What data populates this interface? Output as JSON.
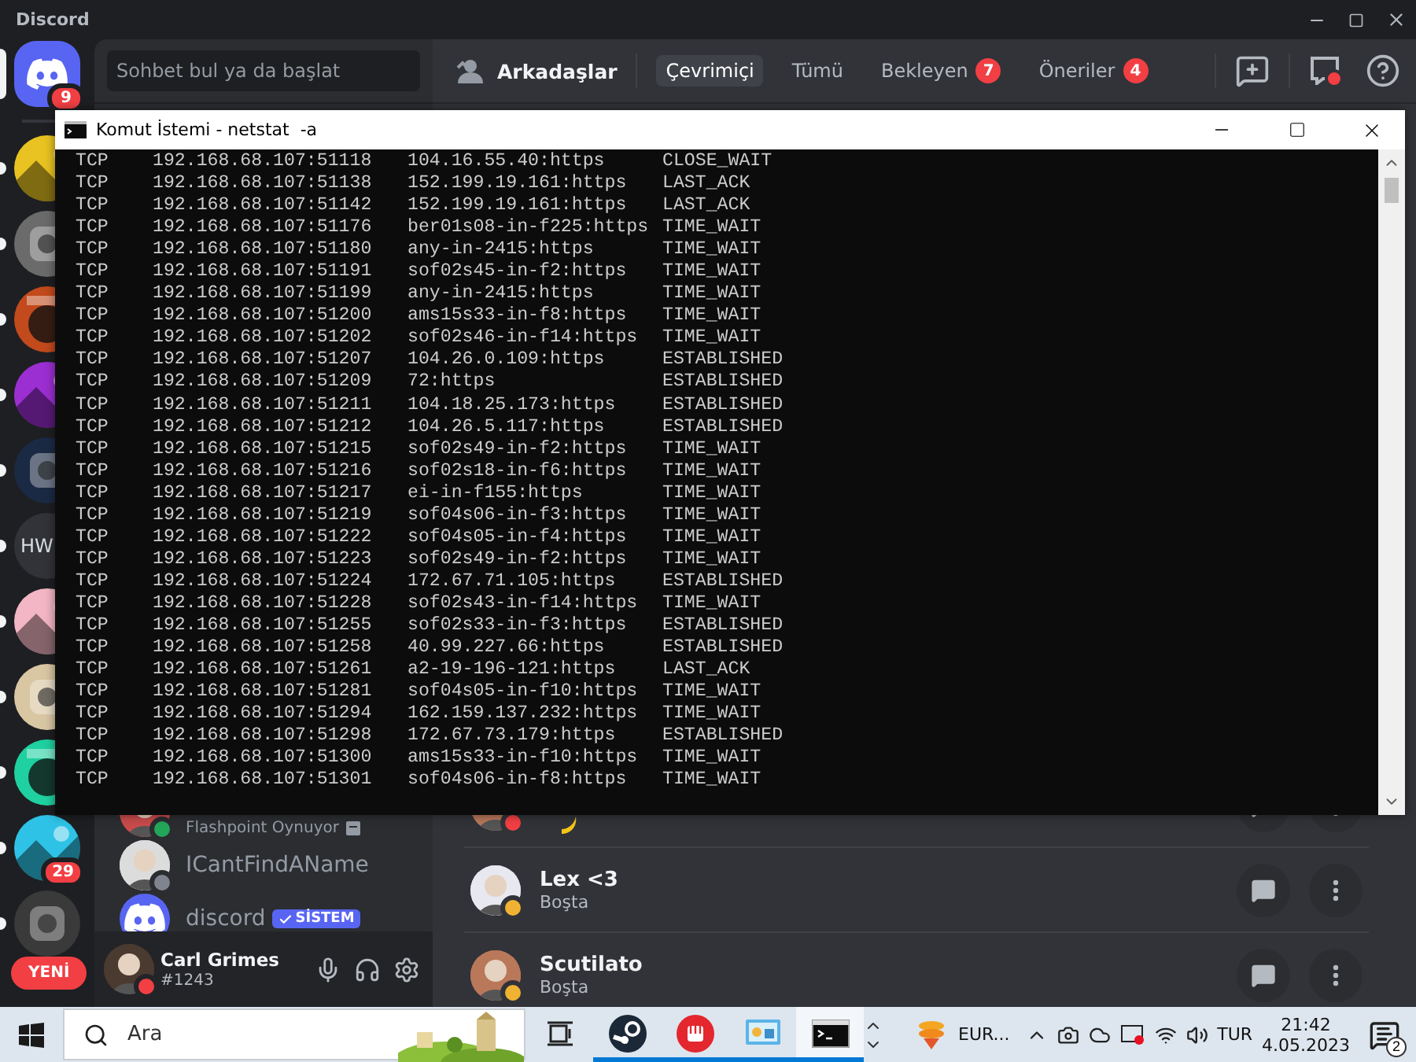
{
  "discord": {
    "title": "Discord",
    "servers": [
      {
        "kind": "home",
        "badge": "9",
        "selected": true
      },
      {
        "kind": "picture",
        "color": "#e8c321",
        "selected": false
      },
      {
        "kind": "picture",
        "color": "#6b6b6b",
        "selected": false
      },
      {
        "kind": "picture",
        "color": "#c24a1c",
        "selected": false
      },
      {
        "kind": "picture",
        "color": "#9b2fd1",
        "selected": false
      },
      {
        "kind": "picture",
        "color": "#1b2a44",
        "selected": false
      },
      {
        "kind": "text",
        "label": "HW",
        "selected": false
      },
      {
        "kind": "picture",
        "color": "#f3b6c4",
        "selected": false
      },
      {
        "kind": "picture",
        "color": "#d9c6a3",
        "selected": false
      },
      {
        "kind": "picture",
        "color": "#1fd1a0",
        "selected": false
      },
      {
        "kind": "picture",
        "color": "#2ec3e6",
        "badge": "29",
        "selected": false
      },
      {
        "kind": "picture",
        "color": "#3a3a3a",
        "selected": false
      }
    ],
    "new_label": "YENİ",
    "search": {
      "placeholder": "Sohbet bul ya da başlat"
    },
    "header": {
      "title": "Arkadaşlar",
      "tabs": [
        {
          "label": "Çevrimiçi",
          "selected": true
        },
        {
          "label": "Tümü",
          "selected": false
        },
        {
          "label": "Bekleyen",
          "badge": "7",
          "selected": false
        },
        {
          "label": "Öneriler",
          "badge": "4",
          "selected": false
        }
      ],
      "inbox_unread": true
    },
    "dm_list": [
      {
        "activity": "Flashpoint Oynuyor",
        "color": "#23a55a"
      },
      {
        "name": "ICantFindAName",
        "color": "#80848e"
      },
      {
        "name": "discord",
        "tag": "SİSTEM"
      }
    ],
    "user": {
      "name": "Carl Grimes",
      "tag": "#1243",
      "color": "#f23f43"
    },
    "friends": [
      {
        "color": "#f23f43",
        "emoji": true
      },
      {
        "name": "Lex <3",
        "activity": "Boşta",
        "color": "#f0b232"
      },
      {
        "name": "Scutilato",
        "activity": "Boşta",
        "color": "#f0b232"
      }
    ]
  },
  "console": {
    "title": "Komut İstemi - netstat  -a",
    "rows": [
      {
        "proto": "TCP",
        "local": "192.168.68.107:51118",
        "foreign": "104.16.55.40:https",
        "state": "CLOSE_WAIT"
      },
      {
        "proto": "TCP",
        "local": "192.168.68.107:51138",
        "foreign": "152.199.19.161:https",
        "state": "LAST_ACK"
      },
      {
        "proto": "TCP",
        "local": "192.168.68.107:51142",
        "foreign": "152.199.19.161:https",
        "state": "LAST_ACK"
      },
      {
        "proto": "TCP",
        "local": "192.168.68.107:51176",
        "foreign": "ber01s08-in-f225:https",
        "state": "TIME_WAIT"
      },
      {
        "proto": "TCP",
        "local": "192.168.68.107:51180",
        "foreign": "any-in-2415:https",
        "state": "TIME_WAIT"
      },
      {
        "proto": "TCP",
        "local": "192.168.68.107:51191",
        "foreign": "sof02s45-in-f2:https",
        "state": "TIME_WAIT"
      },
      {
        "proto": "TCP",
        "local": "192.168.68.107:51199",
        "foreign": "any-in-2415:https",
        "state": "TIME_WAIT"
      },
      {
        "proto": "TCP",
        "local": "192.168.68.107:51200",
        "foreign": "ams15s33-in-f8:https",
        "state": "TIME_WAIT"
      },
      {
        "proto": "TCP",
        "local": "192.168.68.107:51202",
        "foreign": "sof02s46-in-f14:https",
        "state": "TIME_WAIT"
      },
      {
        "proto": "TCP",
        "local": "192.168.68.107:51207",
        "foreign": "104.26.0.109:https",
        "state": "ESTABLISHED"
      },
      {
        "proto": "TCP",
        "local": "192.168.68.107:51209",
        "foreign": "72:https",
        "state": "ESTABLISHED"
      },
      {
        "proto": "TCP",
        "local": "192.168.68.107:51211",
        "foreign": "104.18.25.173:https",
        "state": "ESTABLISHED"
      },
      {
        "proto": "TCP",
        "local": "192.168.68.107:51212",
        "foreign": "104.26.5.117:https",
        "state": "ESTABLISHED"
      },
      {
        "proto": "TCP",
        "local": "192.168.68.107:51215",
        "foreign": "sof02s49-in-f2:https",
        "state": "TIME_WAIT"
      },
      {
        "proto": "TCP",
        "local": "192.168.68.107:51216",
        "foreign": "sof02s18-in-f6:https",
        "state": "TIME_WAIT"
      },
      {
        "proto": "TCP",
        "local": "192.168.68.107:51217",
        "foreign": "ei-in-f155:https",
        "state": "TIME_WAIT"
      },
      {
        "proto": "TCP",
        "local": "192.168.68.107:51219",
        "foreign": "sof04s06-in-f3:https",
        "state": "TIME_WAIT"
      },
      {
        "proto": "TCP",
        "local": "192.168.68.107:51222",
        "foreign": "sof04s05-in-f4:https",
        "state": "TIME_WAIT"
      },
      {
        "proto": "TCP",
        "local": "192.168.68.107:51223",
        "foreign": "sof02s49-in-f2:https",
        "state": "TIME_WAIT"
      },
      {
        "proto": "TCP",
        "local": "192.168.68.107:51224",
        "foreign": "172.67.71.105:https",
        "state": "ESTABLISHED"
      },
      {
        "proto": "TCP",
        "local": "192.168.68.107:51228",
        "foreign": "sof02s43-in-f14:https",
        "state": "TIME_WAIT"
      },
      {
        "proto": "TCP",
        "local": "192.168.68.107:51255",
        "foreign": "sof02s33-in-f3:https",
        "state": "ESTABLISHED"
      },
      {
        "proto": "TCP",
        "local": "192.168.68.107:51258",
        "foreign": "40.99.227.66:https",
        "state": "ESTABLISHED"
      },
      {
        "proto": "TCP",
        "local": "192.168.68.107:51261",
        "foreign": "a2-19-196-121:https",
        "state": "LAST_ACK"
      },
      {
        "proto": "TCP",
        "local": "192.168.68.107:51281",
        "foreign": "sof04s05-in-f10:https",
        "state": "TIME_WAIT"
      },
      {
        "proto": "TCP",
        "local": "192.168.68.107:51294",
        "foreign": "162.159.137.232:https",
        "state": "TIME_WAIT"
      },
      {
        "proto": "TCP",
        "local": "192.168.68.107:51298",
        "foreign": "172.67.73.179:https",
        "state": "ESTABLISHED"
      },
      {
        "proto": "TCP",
        "local": "192.168.68.107:51300",
        "foreign": "ams15s33-in-f10:https",
        "state": "TIME_WAIT"
      },
      {
        "proto": "TCP",
        "local": "192.168.68.107:51301",
        "foreign": "sof04s06-in-f8:https",
        "state": "TIME_WAIT"
      }
    ]
  },
  "taskbar": {
    "search": {
      "placeholder": "Ara"
    },
    "apps": [
      {
        "kind": "taskview",
        "running": false,
        "active": false
      },
      {
        "kind": "steam",
        "running": true,
        "active": false
      },
      {
        "kind": "red",
        "running": true,
        "active": false
      },
      {
        "kind": "monitor",
        "running": true,
        "active": false
      },
      {
        "kind": "console",
        "running": true,
        "active": true
      }
    ],
    "ticker": "EUR...",
    "language": "TUR",
    "time": "21:42",
    "date": "4.05.2023",
    "notifications": "2"
  }
}
